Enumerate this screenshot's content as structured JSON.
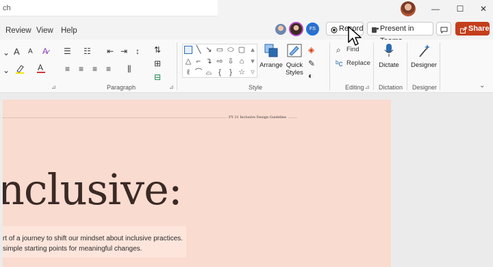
{
  "title_bar": {
    "search_text": "ch",
    "controls": {
      "minimize": "—",
      "maximize": "☐",
      "close": "✕"
    }
  },
  "menu": {
    "tabs": [
      "Review",
      "View",
      "Help"
    ]
  },
  "collab": {
    "avatar3_initials": "FS"
  },
  "actions": {
    "record_label": "Record",
    "present_label": "Present in Teams",
    "share_label": "Share"
  },
  "ribbon": {
    "groups": {
      "paragraph": "Paragraph",
      "style": "Style",
      "editing": "Editing",
      "dictation": "Dictation",
      "designer": "Designer"
    },
    "buttons": {
      "arrange": "Arrange",
      "quick_styles": "Quick Styles",
      "find": "Find",
      "replace": "Replace",
      "dictate": "Dictate",
      "designer": "Designer"
    },
    "font_size_increase": "A",
    "font_size_decrease": "A"
  },
  "slide": {
    "header": "FY 21 Inclusive Design Guideline",
    "title": "nclusive:",
    "body_line1": "rt of a journey to shift our mindset about inclusive practices.",
    "body_line2": "simple starting points for meaningful changes."
  },
  "colors": {
    "accent_share": "#c43e1c",
    "slide_bg": "#fadbcf"
  }
}
